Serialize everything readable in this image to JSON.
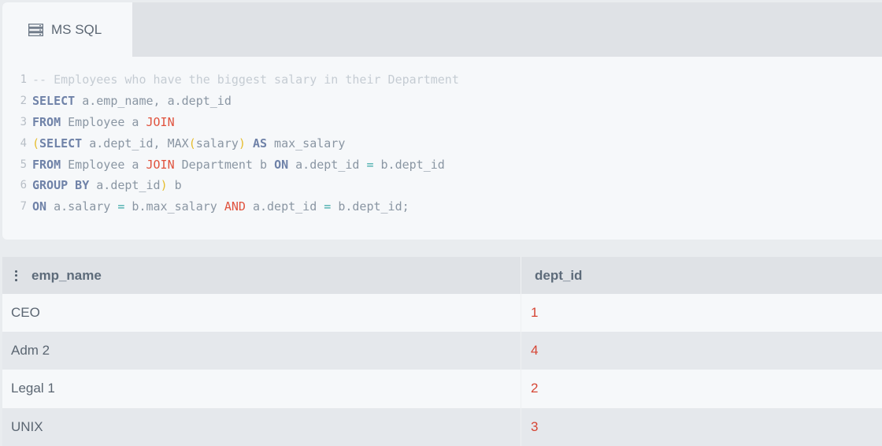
{
  "tab": {
    "icon": "database-icon",
    "label": "MS SQL"
  },
  "code": {
    "line_numbers": [
      "1",
      "2",
      "3",
      "4",
      "5",
      "6",
      "7"
    ],
    "lines": [
      [
        {
          "t": "-- Employees who have the biggest salary in their Department",
          "k": "comment"
        }
      ],
      [
        {
          "t": "SELECT",
          "k": "kw"
        },
        {
          "t": " a.emp_name, a.dept_id",
          "k": "txt"
        }
      ],
      [
        {
          "t": "FROM",
          "k": "kw"
        },
        {
          "t": " Employee a ",
          "k": "txt"
        },
        {
          "t": "JOIN",
          "k": "red"
        }
      ],
      [
        {
          "t": "(",
          "k": "paren"
        },
        {
          "t": "SELECT",
          "k": "kw"
        },
        {
          "t": " a.dept_id, MAX",
          "k": "txt"
        },
        {
          "t": "(",
          "k": "paren"
        },
        {
          "t": "salary",
          "k": "txt"
        },
        {
          "t": ")",
          "k": "paren"
        },
        {
          "t": " ",
          "k": "txt"
        },
        {
          "t": "AS",
          "k": "kw"
        },
        {
          "t": " max_salary",
          "k": "txt"
        }
      ],
      [
        {
          "t": "FROM",
          "k": "kw"
        },
        {
          "t": " Employee a ",
          "k": "txt"
        },
        {
          "t": "JOIN",
          "k": "red"
        },
        {
          "t": " Department b ",
          "k": "txt"
        },
        {
          "t": "ON",
          "k": "kw"
        },
        {
          "t": " a.dept_id ",
          "k": "txt"
        },
        {
          "t": "=",
          "k": "op"
        },
        {
          "t": " b.dept_id",
          "k": "txt"
        }
      ],
      [
        {
          "t": "GROUP BY",
          "k": "kw"
        },
        {
          "t": " a.dept_id",
          "k": "txt"
        },
        {
          "t": ")",
          "k": "paren"
        },
        {
          "t": " b",
          "k": "txt"
        }
      ],
      [
        {
          "t": "ON",
          "k": "kw"
        },
        {
          "t": " a.salary ",
          "k": "txt"
        },
        {
          "t": "=",
          "k": "op"
        },
        {
          "t": " b.max_salary ",
          "k": "txt"
        },
        {
          "t": "AND",
          "k": "red"
        },
        {
          "t": " a.dept_id ",
          "k": "txt"
        },
        {
          "t": "=",
          "k": "op"
        },
        {
          "t": " b.dept_id;",
          "k": "txt"
        }
      ]
    ]
  },
  "result": {
    "menu_icon": "kebab-menu-icon",
    "columns": [
      "emp_name",
      "dept_id"
    ],
    "rows": [
      [
        "CEO",
        "1"
      ],
      [
        "Adm 2",
        "4"
      ],
      [
        "Legal 1",
        "2"
      ],
      [
        "UNIX",
        "3"
      ]
    ]
  },
  "colors": {
    "keyword": "#6f82a8",
    "keyword_red": "#e0533e",
    "comment": "#c5ccd3",
    "paren": "#e6bd2e",
    "operator": "#39a7a6",
    "value_red": "#d64534"
  }
}
